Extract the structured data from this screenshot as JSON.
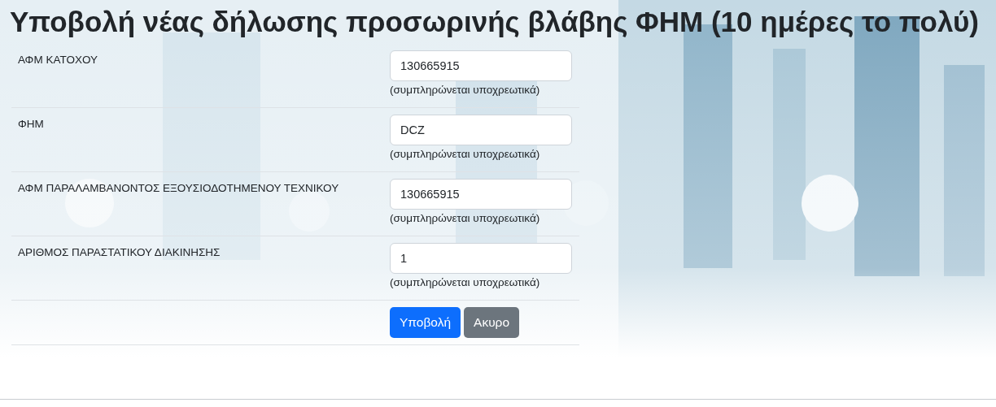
{
  "title": "Υποβολή νέας δήλωσης προσωρινής βλάβης ΦΗΜ (10 ημέρες το πολύ)",
  "fields": [
    {
      "label": "ΑΦΜ ΚΑΤΟΧΟΥ",
      "value": "130665915",
      "hint": "(συμπληρώνεται υποχρεωτικά)"
    },
    {
      "label": "ΦΗΜ",
      "value": "DCZ",
      "hint": "(συμπληρώνεται υποχρεωτικά)"
    },
    {
      "label": "ΑΦΜ ΠΑΡΑΛΑΜΒΑΝΟΝΤΟΣ ΕΞΟΥΣΙΟΔΟΤΗΜΕΝΟΥ ΤΕΧΝΙΚΟΥ",
      "value": "130665915",
      "hint": "(συμπληρώνεται υποχρεωτικά)"
    },
    {
      "label": "ΑΡΙΘΜΟΣ ΠΑΡΑΣΤΑΤΙΚΟΥ ΔΙΑΚΙΝΗΣΗΣ",
      "value": "1",
      "hint": "(συμπληρώνεται υποχρεωτικά)"
    }
  ],
  "buttons": [
    {
      "label": "Υποβολή",
      "kind": "primary"
    },
    {
      "label": "Ακυρο",
      "kind": "secondary"
    }
  ]
}
